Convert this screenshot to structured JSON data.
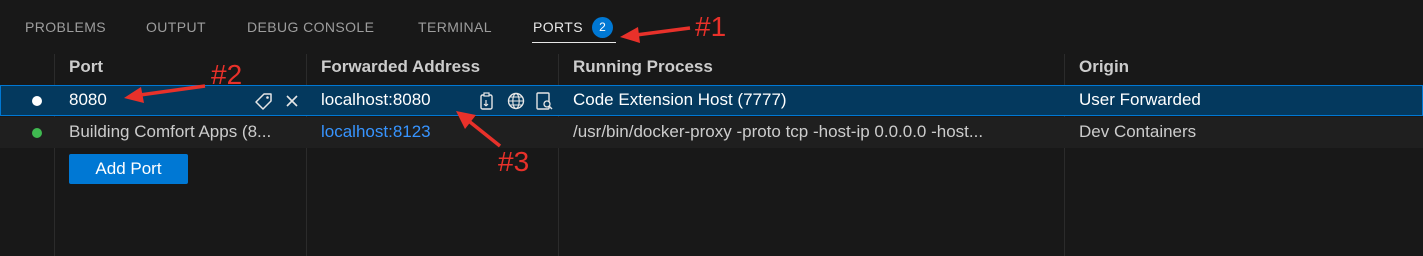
{
  "panel": {
    "tabs": [
      {
        "label": "PROBLEMS"
      },
      {
        "label": "OUTPUT"
      },
      {
        "label": "DEBUG CONSOLE"
      },
      {
        "label": "TERMINAL"
      },
      {
        "label": "PORTS",
        "badge": "2",
        "active": true
      }
    ]
  },
  "table": {
    "columns": [
      "Port",
      "Forwarded Address",
      "Running Process",
      "Origin"
    ],
    "rows": [
      {
        "status": "white",
        "port": "8080",
        "address": "localhost:8080",
        "process": "Code Extension Host (7777)",
        "origin": "User Forwarded",
        "selected": true
      },
      {
        "status": "green",
        "port": "Building Comfort Apps (8...",
        "address": "localhost:8123",
        "process": "/usr/bin/docker-proxy -proto tcp -host-ip 0.0.0.0 -host...",
        "origin": "Dev Containers",
        "selected": false
      }
    ],
    "add_port_label": "Add Port"
  },
  "annotations": [
    "#1",
    "#2",
    "#3"
  ],
  "colors": {
    "background": "#181818",
    "selection": "#04395e",
    "accent": "#0078d4",
    "link": "#3794ff",
    "status_running": "#3fb950",
    "annotation": "#e8312a"
  },
  "icons": {
    "port_actions": [
      "tag-icon",
      "close-icon"
    ],
    "address_actions": [
      "copy-icon",
      "globe-icon",
      "preview-icon"
    ]
  }
}
